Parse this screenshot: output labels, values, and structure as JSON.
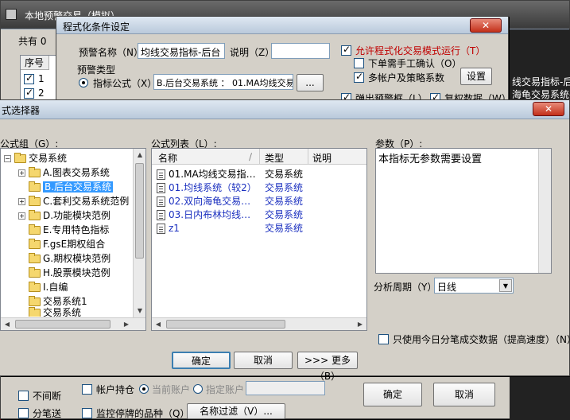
{
  "bg_window": {
    "title": "本地预警交易（模拟）",
    "count_label": "共有 0",
    "table": {
      "col_seq": "序号",
      "rows": [
        "1",
        "2"
      ]
    },
    "bottom": {
      "no_interval_label": "不间断",
      "split_label": "分笔送",
      "account_label": "帐户持仓",
      "current_account_label": "当前账户",
      "specified_account_label": "指定账户",
      "monitor_label": "监控停牌的品种（Q）",
      "name_filter_btn": "名称过滤（V）...",
      "ok_btn": "确定",
      "cancel_btn": "取消"
    }
  },
  "cond_window": {
    "title": "程式化条件设定",
    "name_label": "预警名称（N）:",
    "name_value": "均线交易指标-后台",
    "desc_label": "说明（Z）:",
    "desc_value": "",
    "allow_program_label": "允许程式化交易模式运行（T）",
    "manual_confirm_label": "下单需手工确认（O）",
    "multi_account_label": "多帐户及策略系数",
    "setup_btn": "设置",
    "type_group": "预警类型",
    "indicator_radio": "指标公式（X）",
    "indicator_value": "B.后台交易系统 ： 01.MA均线交易",
    "browse_btn": "...",
    "popup_alert_label": "弹出预警框（L）",
    "reset_data_label": "复权数据（W）",
    "right_hint_1": "线交易指标-后台",
    "right_hint_2": "海龟交易系统-后"
  },
  "selector": {
    "title": "式选择器",
    "group_label": "公式组（G）:",
    "list_label": "公式列表（L）:",
    "param_label": "参数（P）:",
    "param_text": "本指标无参数需要设置",
    "period_label": "分析周期（Y）:",
    "period_value": "日线",
    "only_today_label": "只使用今日分笔成交数据（提高速度）（N）",
    "ok_btn": "确定",
    "cancel_btn": "取消",
    "more_btn": ">>> 更多（B）",
    "tree": [
      "交易系统",
      "A.图表交易系统",
      "B.后台交易系统",
      "C.套利交易系统范例",
      "D.功能模块范例",
      "E.专用特色指标",
      "F.gsE期权组合",
      "G.期权模块范例",
      "H.股票模块范例",
      "I.自编",
      "交易系统1",
      "交易系统"
    ],
    "list_headers": {
      "name": "名称",
      "type": "类型",
      "desc": "说明"
    },
    "list_rows": [
      {
        "name": "01.MA均线交易指…",
        "type": "交易系统"
      },
      {
        "name": "01.均线系统（较2）",
        "type": "交易系统"
      },
      {
        "name": "02.双向海龟交易…",
        "type": "交易系统"
      },
      {
        "name": "03.日内布林均线…",
        "type": "交易系统"
      },
      {
        "name": "z1",
        "type": "交易系统"
      }
    ]
  }
}
